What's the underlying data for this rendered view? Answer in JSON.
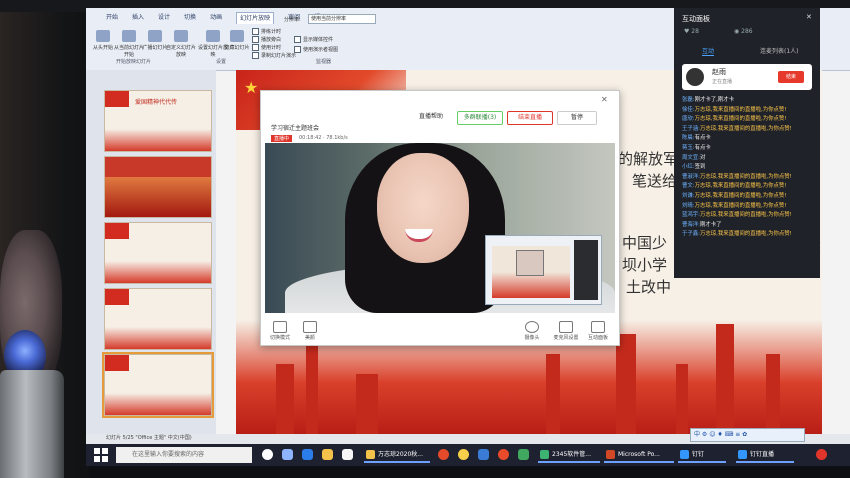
{
  "ribbon": {
    "tabs": [
      "开始",
      "插入",
      "设计",
      "切换",
      "动画",
      "幻灯片放映",
      "审阅",
      "视图"
    ],
    "active_tab": "幻灯片放映",
    "buttons": [
      "从头开始",
      "从当前幻灯片开始",
      "广播幻灯片",
      "自定义幻灯片放映",
      "设置幻灯片放映",
      "隐藏幻灯片",
      "排练计时",
      "录制幻灯片演示"
    ],
    "checks": [
      "播放旁白",
      "使用计时",
      "显示媒体控件",
      "使用演示者视图"
    ],
    "resolution_label": "分辨率:",
    "resolution_value": "使用当前分辨率",
    "group_labels": [
      "开始放映幻灯片",
      "设置",
      "监视器"
    ]
  },
  "slides": [
    {
      "num": "1",
      "title": "爱国精神代代传"
    },
    {
      "num": "2",
      "title": ""
    },
    {
      "num": "3",
      "title": ""
    },
    {
      "num": "4",
      "title": ""
    },
    {
      "num": "5",
      "title": ""
    }
  ],
  "slide_poem": {
    "line1": "的解放军",
    "line2": "笔送给",
    "line3": "中国少",
    "line4": "坝小学",
    "line5": "土改中",
    "edge": "在"
  },
  "live_window": {
    "title": "学习宿迁主题班会",
    "badge": "直播中",
    "time": "00:18:42",
    "bitrate": "78.1kb/s",
    "btn_help": "直播帮助",
    "btn_multi": "多群联播(3)",
    "btn_end": "结束直播",
    "btn_pause": "暂停",
    "controls": [
      "切换模式",
      "美颜",
      "摄像头",
      "麦克风设置",
      "互动面板"
    ]
  },
  "panel": {
    "title": "互动面板",
    "likes": "28",
    "views": "286",
    "tab_left": "互动",
    "tab_right": "连麦列表(1人)",
    "host_name": "赵雨",
    "host_sub": "正在直播",
    "host_btn": "结束",
    "messages": [
      {
        "user": "张磊:",
        "text": "刚才卡了,刚才卡"
      },
      {
        "user": "徐佳:",
        "text": "万志琼,我来直播间的直播啦,为你点赞!"
      },
      {
        "user": "唐欣:",
        "text": "万志琼,我来直播间的直播啦,为你点赞!"
      },
      {
        "user": "王子涵:",
        "text": "万志琼,我来直播间的直播啦,为你点赞!"
      },
      {
        "user": "陈晨:",
        "text": "有点卡"
      },
      {
        "user": "蒋玉:",
        "text": "有点卡"
      },
      {
        "user": "周文宣:",
        "text": "对"
      },
      {
        "user": "小红:",
        "text": "签到"
      },
      {
        "user": "曹淑洋:",
        "text": "万志琼,我来直播间的直播啦,为你点赞!"
      },
      {
        "user": "曹文:",
        "text": "万志琼,我来直播间的直播啦,为你点赞!"
      },
      {
        "user": "刘谦:",
        "text": "万志琼,我来直播间的直播啦,为你点赞!"
      },
      {
        "user": "刘晴:",
        "text": "万志琼,我来直播间的直播啦,为你点赞!"
      },
      {
        "user": "蓝鸿宇:",
        "text": "万志琼,我来直播间的直播啦,为你点赞!"
      },
      {
        "user": "曹海洋:",
        "text": "刚才卡了"
      },
      {
        "user": "于子鑫:",
        "text": "万志琼,我来直播间的直播啦,为你点赞!"
      }
    ]
  },
  "statusbar": {
    "left": "幻灯片 5/25   \"Office 主题\"   中文(中国)",
    "ime": "中 ⚙ ☺ ♦ ⌨ ≡ ✿"
  },
  "taskbar": {
    "search_placeholder": "在这里输入你要搜索的内容",
    "items": [
      "万志琼2020秋...",
      "2345软件管...",
      "Microsoft Po...",
      "钉钉",
      "钉钉直播"
    ]
  },
  "colors": {
    "accent_red": "#e0352b",
    "panel_bg": "#1f2329",
    "slide_red": "#c42a1c"
  }
}
